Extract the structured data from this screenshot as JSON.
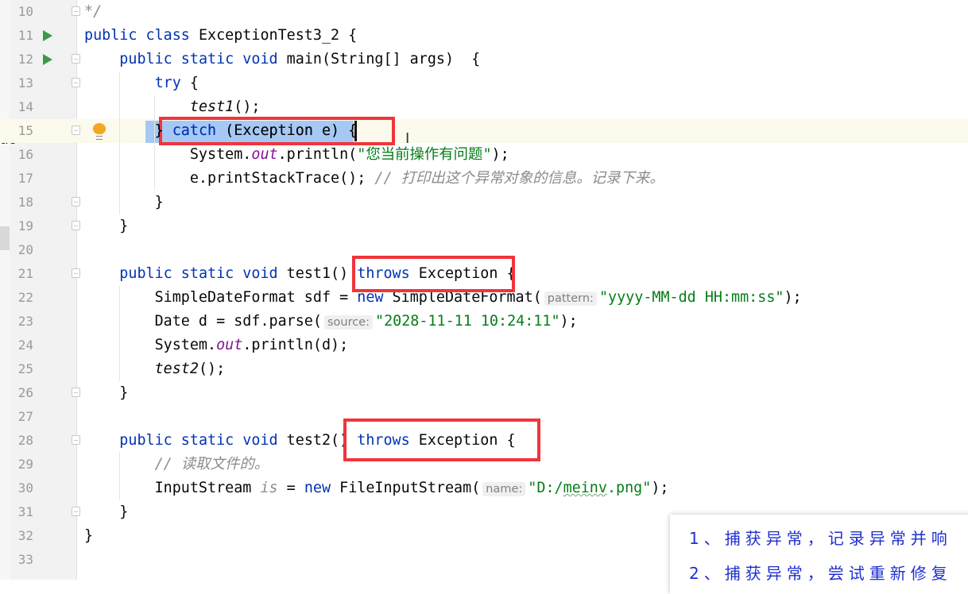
{
  "editor": {
    "left_panel_cut_text": "tic",
    "current_line": 15,
    "lines": [
      {
        "num": "10",
        "run": false,
        "fold": true,
        "tokens": [
          {
            "t": "*/",
            "c": "cm"
          }
        ]
      },
      {
        "num": "11",
        "run": true,
        "fold": false,
        "tokens": [
          {
            "t": "public class ",
            "c": "kw"
          },
          {
            "t": "ExceptionTest3_2 {",
            "c": ""
          }
        ]
      },
      {
        "num": "12",
        "run": true,
        "fold": true,
        "tokens": [
          {
            "t": "    ",
            "c": ""
          },
          {
            "t": "public static void ",
            "c": "kw"
          },
          {
            "t": "main(String[] args)  {",
            "c": ""
          }
        ]
      },
      {
        "num": "13",
        "run": false,
        "fold": true,
        "tokens": [
          {
            "t": "        ",
            "c": ""
          },
          {
            "t": "try ",
            "c": "kw"
          },
          {
            "t": "{",
            "c": ""
          }
        ]
      },
      {
        "num": "14",
        "run": false,
        "fold": false,
        "tokens": [
          {
            "t": "            ",
            "c": ""
          },
          {
            "t": "test1",
            "c": "st"
          },
          {
            "t": "();",
            "c": ""
          }
        ]
      },
      {
        "num": "15",
        "run": false,
        "fold": true,
        "bulb": true,
        "tokens": [
          {
            "t": "        } ",
            "c": ""
          },
          {
            "t": "catch ",
            "c": "kw"
          },
          {
            "t": "(Exception e) {",
            "c": ""
          }
        ]
      },
      {
        "num": "16",
        "run": false,
        "fold": false,
        "tokens": [
          {
            "t": "            System.",
            "c": ""
          },
          {
            "t": "out",
            "c": "fd"
          },
          {
            "t": ".println(",
            "c": ""
          },
          {
            "t": "\"您当前操作有问题\"",
            "c": "str"
          },
          {
            "t": ");",
            "c": ""
          }
        ]
      },
      {
        "num": "17",
        "run": false,
        "fold": false,
        "tokens": [
          {
            "t": "            e.printStackTrace(); ",
            "c": ""
          },
          {
            "t": "// 打印出这个异常对象的信息。记录下来。",
            "c": "cm"
          }
        ]
      },
      {
        "num": "18",
        "run": false,
        "fold": true,
        "tokens": [
          {
            "t": "        }",
            "c": ""
          }
        ]
      },
      {
        "num": "19",
        "run": false,
        "fold": true,
        "tokens": [
          {
            "t": "    }",
            "c": ""
          }
        ]
      },
      {
        "num": "20",
        "run": false,
        "fold": false,
        "tokens": []
      },
      {
        "num": "21",
        "run": false,
        "fold": true,
        "tokens": [
          {
            "t": "    ",
            "c": ""
          },
          {
            "t": "public static void ",
            "c": "kw"
          },
          {
            "t": "test1() ",
            "c": ""
          },
          {
            "t": "throws ",
            "c": "kw"
          },
          {
            "t": "Exception {",
            "c": ""
          }
        ]
      },
      {
        "num": "22",
        "run": false,
        "fold": false,
        "tokens": [
          {
            "t": "        SimpleDateFormat sdf = ",
            "c": ""
          },
          {
            "t": "new ",
            "c": "kw"
          },
          {
            "t": "SimpleDateFormat(",
            "c": ""
          },
          {
            "t": "pattern:",
            "c": "hint"
          },
          {
            "t": "\"yyyy-MM-dd HH:mm:ss\"",
            "c": "str"
          },
          {
            "t": ");",
            "c": ""
          }
        ]
      },
      {
        "num": "23",
        "run": false,
        "fold": false,
        "tokens": [
          {
            "t": "        Date d = sdf.parse(",
            "c": ""
          },
          {
            "t": "source:",
            "c": "hint"
          },
          {
            "t": "\"2028-11-11 10:24:11\"",
            "c": "str"
          },
          {
            "t": ");",
            "c": ""
          }
        ]
      },
      {
        "num": "24",
        "run": false,
        "fold": false,
        "tokens": [
          {
            "t": "        System.",
            "c": ""
          },
          {
            "t": "out",
            "c": "fd"
          },
          {
            "t": ".println(d);",
            "c": ""
          }
        ]
      },
      {
        "num": "25",
        "run": false,
        "fold": false,
        "tokens": [
          {
            "t": "        ",
            "c": ""
          },
          {
            "t": "test2",
            "c": "st"
          },
          {
            "t": "();",
            "c": ""
          }
        ]
      },
      {
        "num": "26",
        "run": false,
        "fold": true,
        "tokens": [
          {
            "t": "    }",
            "c": ""
          }
        ]
      },
      {
        "num": "27",
        "run": false,
        "fold": false,
        "tokens": []
      },
      {
        "num": "28",
        "run": false,
        "fold": true,
        "tokens": [
          {
            "t": "    ",
            "c": ""
          },
          {
            "t": "public static void ",
            "c": "kw"
          },
          {
            "t": "test2() ",
            "c": ""
          },
          {
            "t": "throws ",
            "c": "kw"
          },
          {
            "t": "Exception {",
            "c": ""
          }
        ]
      },
      {
        "num": "29",
        "run": false,
        "fold": false,
        "tokens": [
          {
            "t": "        ",
            "c": ""
          },
          {
            "t": "// 读取文件的。",
            "c": "cm"
          }
        ]
      },
      {
        "num": "30",
        "run": false,
        "fold": false,
        "tokens": [
          {
            "t": "        InputStream ",
            "c": ""
          },
          {
            "t": "is",
            "c": "cm"
          },
          {
            "t": " = ",
            "c": ""
          },
          {
            "t": "new ",
            "c": "kw"
          },
          {
            "t": "FileInputStream(",
            "c": ""
          },
          {
            "t": "name:",
            "c": "hint"
          },
          {
            "t": "\"D:/",
            "c": "str"
          },
          {
            "t": "meinv",
            "c": "str squig"
          },
          {
            "t": ".png\"",
            "c": "str"
          },
          {
            "t": ");",
            "c": ""
          }
        ]
      },
      {
        "num": "31",
        "run": false,
        "fold": true,
        "tokens": [
          {
            "t": "    }",
            "c": ""
          }
        ]
      },
      {
        "num": "32",
        "run": false,
        "fold": false,
        "tokens": [
          {
            "t": "}",
            "c": ""
          }
        ]
      },
      {
        "num": "33",
        "run": false,
        "fold": false,
        "tokens": []
      }
    ]
  },
  "annotation": {
    "color": "#1f2ed1",
    "highlight_color": "#f0353a",
    "items": [
      "1、捕获异常，记录异常并响",
      "2、捕获异常，尝试重新修复"
    ]
  }
}
